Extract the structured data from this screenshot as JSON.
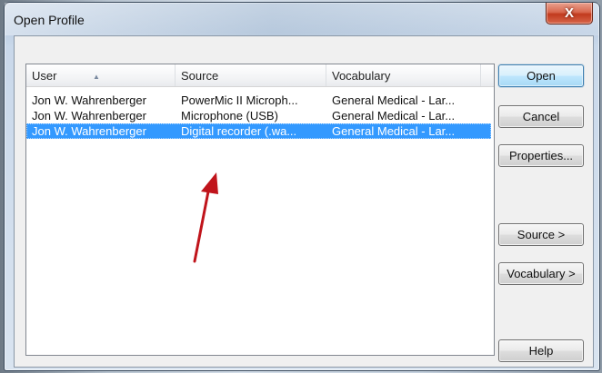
{
  "window": {
    "title": "Open Profile",
    "close_glyph": "X"
  },
  "list": {
    "columns": [
      "User",
      "Source",
      "Vocabulary"
    ],
    "sort_column": "User",
    "sort_indicator": "ascending",
    "rows": [
      {
        "user": "Jon W. Wahrenberger",
        "source": "PowerMic II Microph...",
        "vocabulary": "General Medical - Lar...",
        "selected": false
      },
      {
        "user": "Jon W. Wahrenberger",
        "source": "Microphone (USB)",
        "vocabulary": "General Medical - Lar...",
        "selected": false
      },
      {
        "user": "Jon W. Wahrenberger",
        "source": "Digital recorder (.wa...",
        "vocabulary": "General Medical - Lar...",
        "selected": true
      }
    ]
  },
  "buttons": {
    "open": "Open",
    "cancel": "Cancel",
    "properties": "Properties...",
    "source": "Source >",
    "vocabulary": "Vocabulary >",
    "help": "Help"
  },
  "colors": {
    "selection": "#3399ff",
    "annotation_arrow": "#c0141b"
  },
  "icons": {
    "sort": "sort-ascending-icon",
    "close": "close-icon",
    "annotation": "red-arrow-annotation"
  }
}
